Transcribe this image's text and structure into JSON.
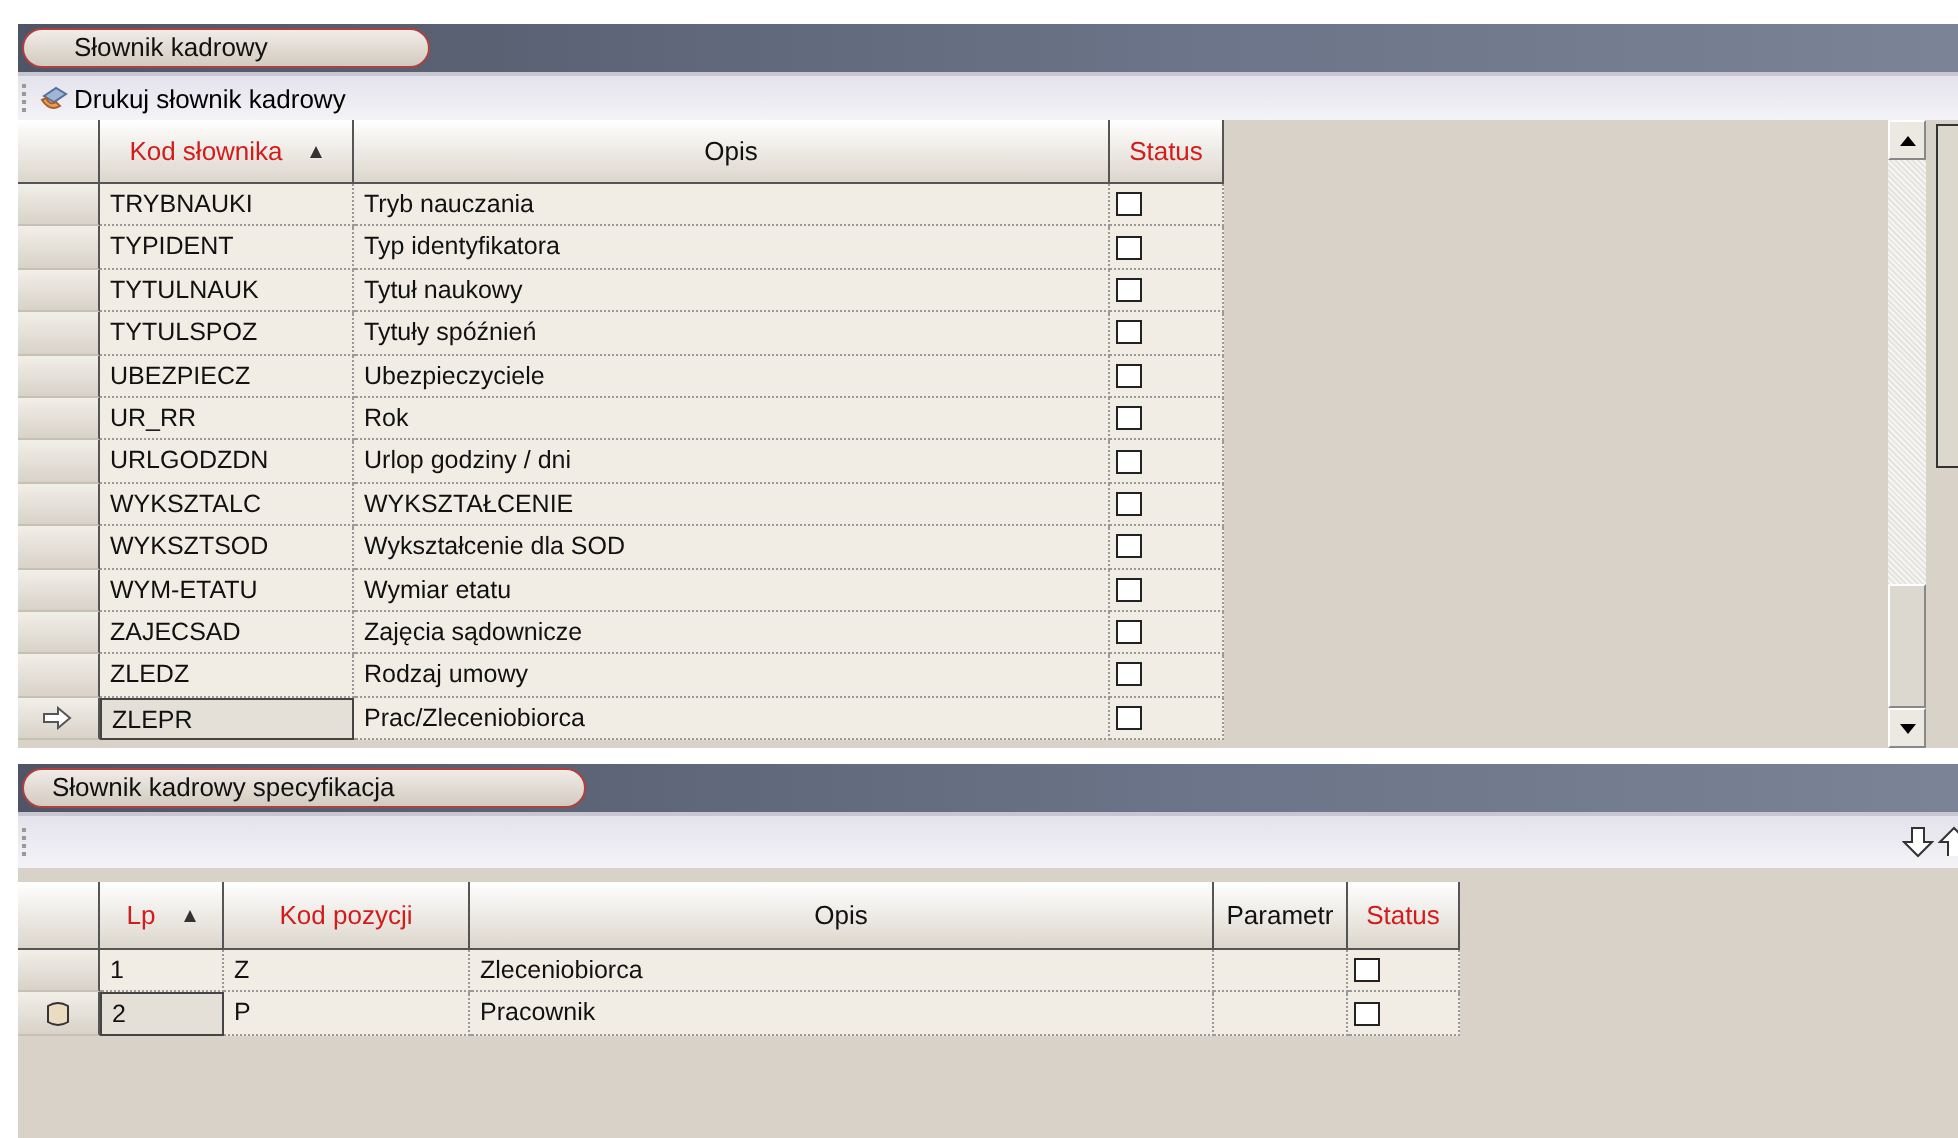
{
  "top_panel": {
    "title": "Słownik kadrowy",
    "toolbar": {
      "print_button": "Drukuj słownik kadrowy"
    },
    "table": {
      "columns": [
        {
          "label": "Kod słownika",
          "required": true,
          "sorted": true
        },
        {
          "label": "Opis",
          "required": false,
          "sorted": false
        },
        {
          "label": "Status",
          "required": true,
          "sorted": false
        }
      ],
      "rows": [
        {
          "code": "TRYBNAUKI",
          "description": "Tryb nauczania",
          "checked": false,
          "selected": false
        },
        {
          "code": "TYPIDENT",
          "description": "Typ identyfikatora",
          "checked": false,
          "selected": false
        },
        {
          "code": "TYTULNAUK",
          "description": "Tytuł naukowy",
          "checked": false,
          "selected": false
        },
        {
          "code": "TYTULSPOZ",
          "description": "Tytuły spóźnień",
          "checked": false,
          "selected": false
        },
        {
          "code": "UBEZPIECZ",
          "description": "Ubezpieczyciele",
          "checked": false,
          "selected": false
        },
        {
          "code": "UR_RR",
          "description": "Rok",
          "checked": false,
          "selected": false
        },
        {
          "code": "URLGODZDN",
          "description": "Urlop godziny / dni",
          "checked": false,
          "selected": false
        },
        {
          "code": "WYKSZTALC",
          "description": "WYKSZTAŁCENIE",
          "checked": false,
          "selected": false
        },
        {
          "code": "WYKSZTSOD",
          "description": "Wykształcenie dla SOD",
          "checked": false,
          "selected": false
        },
        {
          "code": "WYM-ETATU",
          "description": "Wymiar etatu",
          "checked": false,
          "selected": false
        },
        {
          "code": "ZAJECSAD",
          "description": "Zajęcia sądownicze",
          "checked": false,
          "selected": false
        },
        {
          "code": "ZLEDZ",
          "description": "Rodzaj umowy",
          "checked": false,
          "selected": false
        },
        {
          "code": "ZLEPR",
          "description": "Prac/Zleceniobiorca",
          "checked": false,
          "selected": true
        }
      ]
    }
  },
  "bottom_panel": {
    "title": "Słownik kadrowy specyfikacja",
    "table": {
      "columns": [
        {
          "label": "Lp",
          "required": true,
          "sorted": true
        },
        {
          "label": "Kod pozycji",
          "required": true,
          "sorted": false
        },
        {
          "label": "Opis",
          "required": false,
          "sorted": false
        },
        {
          "label": "Parametr",
          "required": false,
          "sorted": false
        },
        {
          "label": "Status",
          "required": true,
          "sorted": false
        }
      ],
      "rows": [
        {
          "lp": "1",
          "code": "Z",
          "description": "Zleceniobiorca",
          "checked": false,
          "selected": false
        },
        {
          "lp": "2",
          "code": "P",
          "description": "Pracownik",
          "checked": false,
          "selected": true
        }
      ]
    }
  }
}
